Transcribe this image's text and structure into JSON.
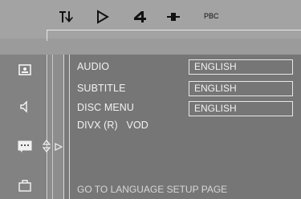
{
  "toolbar": {
    "items": [
      {
        "icon": "settings-tools-icon"
      },
      {
        "icon": "play-icon"
      },
      {
        "icon": "audio-4-icon"
      },
      {
        "icon": "speaker-icon"
      },
      {
        "label": "PBC"
      }
    ]
  },
  "sidebar": {
    "items": [
      {
        "icon": "general-setup-icon"
      },
      {
        "icon": "audio-setup-icon"
      },
      {
        "icon": "language-setup-icon",
        "selected": true
      },
      {
        "icon": "preference-setup-icon"
      }
    ]
  },
  "language_setup": {
    "rows": [
      {
        "label": "AUDIO",
        "value": "ENGLISH"
      },
      {
        "label": "SUBTITLE",
        "value": "ENGLISH"
      },
      {
        "label": "DISC MENU",
        "value": "ENGLISH"
      },
      {
        "label": "DIVX (R)   VOD",
        "value": ""
      }
    ],
    "footer": "GO TO LANGUAGE SETUP PAGE"
  },
  "colors": {
    "background": "#9b9b9b",
    "panel": "#767676",
    "text": "#f2f2f2"
  }
}
